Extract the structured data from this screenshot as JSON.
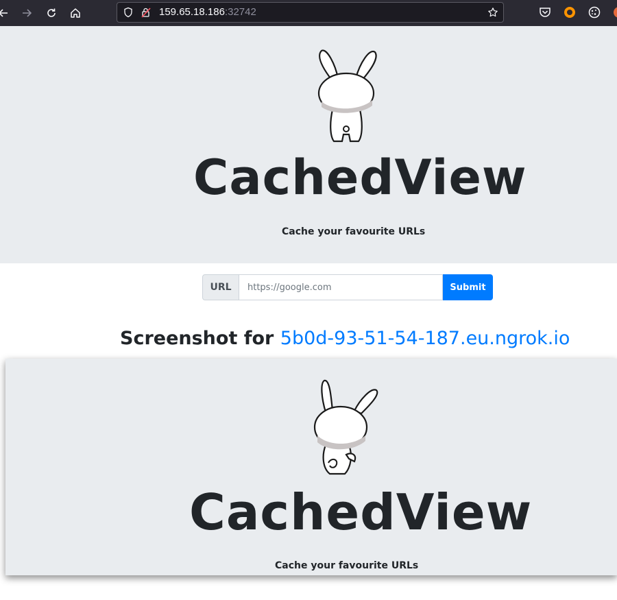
{
  "browser": {
    "url_host": "159.65.18.186",
    "url_port": ":32742",
    "icons": [
      "back-icon",
      "forward-icon",
      "reload-icon",
      "home-icon",
      "shield-icon",
      "lock-warning-icon",
      "bookmark-star-icon",
      "pocket-icon",
      "extension-icon",
      "cookie-icon",
      "account-icon"
    ]
  },
  "header": {
    "title": "CachedView",
    "tagline": "Cache your favourite URLs"
  },
  "form": {
    "label": "URL",
    "placeholder": "https://google.com",
    "value": "",
    "submit_label": "Submit"
  },
  "result": {
    "heading_prefix": "Screenshot for ",
    "link_text": "5b0d-93-51-54-187.eu.ngrok.io"
  },
  "screenshot": {
    "title": "CachedView",
    "tagline": "Cache your favourite URLs"
  },
  "colors": {
    "jumbotron": "#e9ecef",
    "primary": "#007bff",
    "text": "#212529",
    "toolbar": "#2b2a33"
  }
}
